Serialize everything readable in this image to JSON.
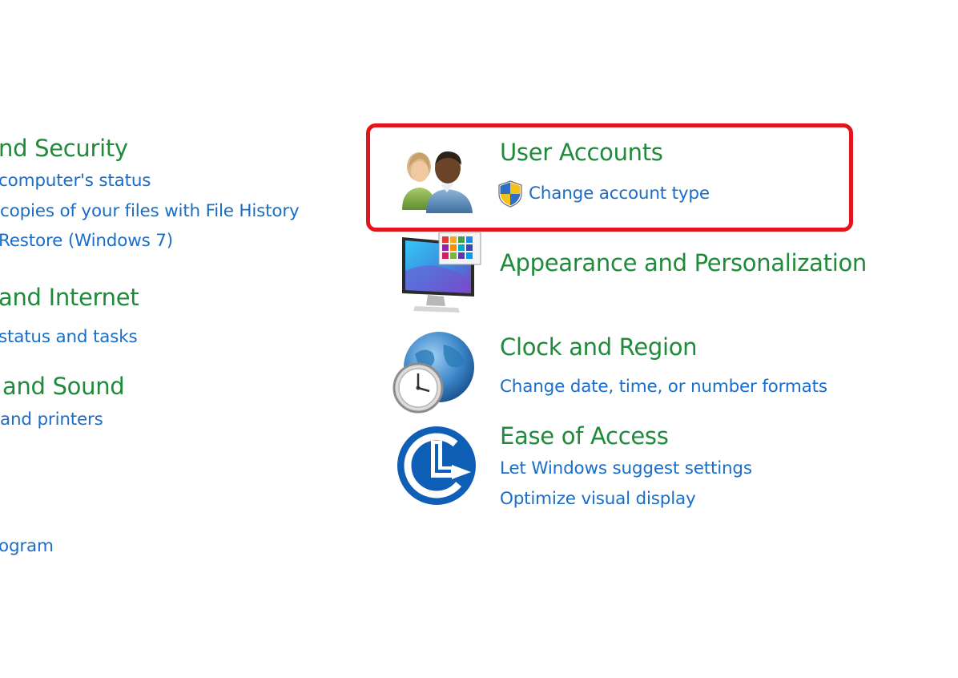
{
  "left_column": {
    "system_security": {
      "title": "nd Security",
      "links": [
        "computer's status",
        "copies of your files with File History",
        "Restore (Windows 7)"
      ]
    },
    "network_internet": {
      "title": "and Internet",
      "links": [
        "status and tasks"
      ]
    },
    "hardware_sound": {
      "title": "and Sound",
      "links": [
        "and printers"
      ]
    },
    "programs": {
      "links": [
        "ogram"
      ]
    }
  },
  "right_column": {
    "user_accounts": {
      "title": "User Accounts",
      "links": [
        "Change account type"
      ],
      "icon": "users-icon",
      "link_icon": "uac-shield-icon"
    },
    "appearance": {
      "title": "Appearance and Personalization",
      "icon": "monitor-palette-icon"
    },
    "clock_region": {
      "title": "Clock and Region",
      "links": [
        "Change date, time, or number formats"
      ],
      "icon": "globe-clock-icon"
    },
    "ease_of_access": {
      "title": "Ease of Access",
      "links": [
        "Let Windows suggest settings",
        "Optimize visual display"
      ],
      "icon": "ease-of-access-icon"
    }
  },
  "colors": {
    "title_green": "#1e8a3a",
    "link_blue": "#1a6dc8",
    "highlight_red": "#e3141b"
  }
}
